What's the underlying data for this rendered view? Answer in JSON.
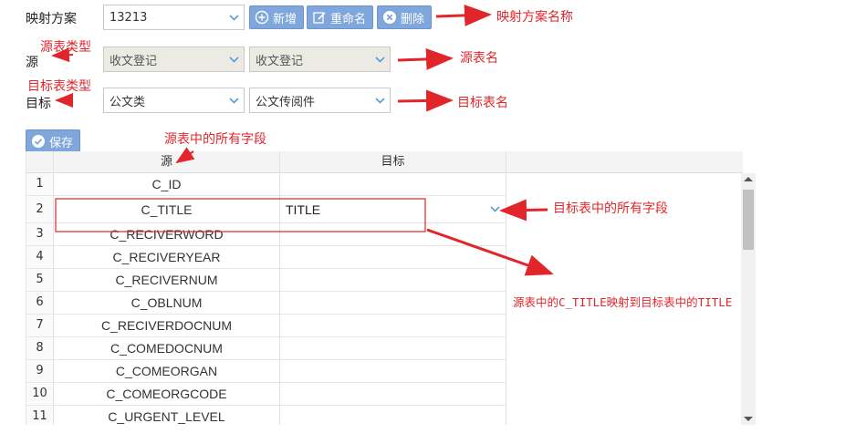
{
  "scheme": {
    "label": "映射方案",
    "value": "13213",
    "buttons": {
      "add": "新增",
      "rename": "重命名",
      "delete": "删除"
    }
  },
  "source": {
    "label": "源",
    "type_value": "收文登记",
    "table_value": "收文登记"
  },
  "target": {
    "label": "目标",
    "type_value": "公文类",
    "table_value": "公文传阅件"
  },
  "save_label": "保存",
  "grid": {
    "headers": {
      "source": "源",
      "target": "目标"
    },
    "rows": [
      {
        "num": "1",
        "source": "C_ID",
        "target": ""
      },
      {
        "num": "2",
        "source": "C_TITLE",
        "target": "TITLE"
      },
      {
        "num": "3",
        "source": "C_RECIVERWORD",
        "target": ""
      },
      {
        "num": "4",
        "source": "C_RECIVERYEAR",
        "target": ""
      },
      {
        "num": "5",
        "source": "C_RECIVERNUM",
        "target": ""
      },
      {
        "num": "6",
        "source": "C_OBLNUM",
        "target": ""
      },
      {
        "num": "7",
        "source": "C_RECIVERDOCNUM",
        "target": ""
      },
      {
        "num": "8",
        "source": "C_COMEDOCNUM",
        "target": ""
      },
      {
        "num": "9",
        "source": "C_COMEORGAN",
        "target": ""
      },
      {
        "num": "10",
        "source": "C_COMEORGCODE",
        "target": ""
      },
      {
        "num": "11",
        "source": "C_URGENT_LEVEL",
        "target": ""
      }
    ]
  },
  "annotations": {
    "scheme_name": "映射方案名称",
    "source_type": "源表类型",
    "source_table": "源表名",
    "target_type": "目标表类型",
    "target_table": "目标表名",
    "source_fields": "源表中的所有字段",
    "target_fields": "目标表中的所有字段",
    "mapping_note": "源表中的C_TITLE映射到目标表中的TITLE"
  },
  "colors": {
    "button": "#7fa7dc",
    "annotation": "#e0262b",
    "caret": "#5b9bd5"
  }
}
